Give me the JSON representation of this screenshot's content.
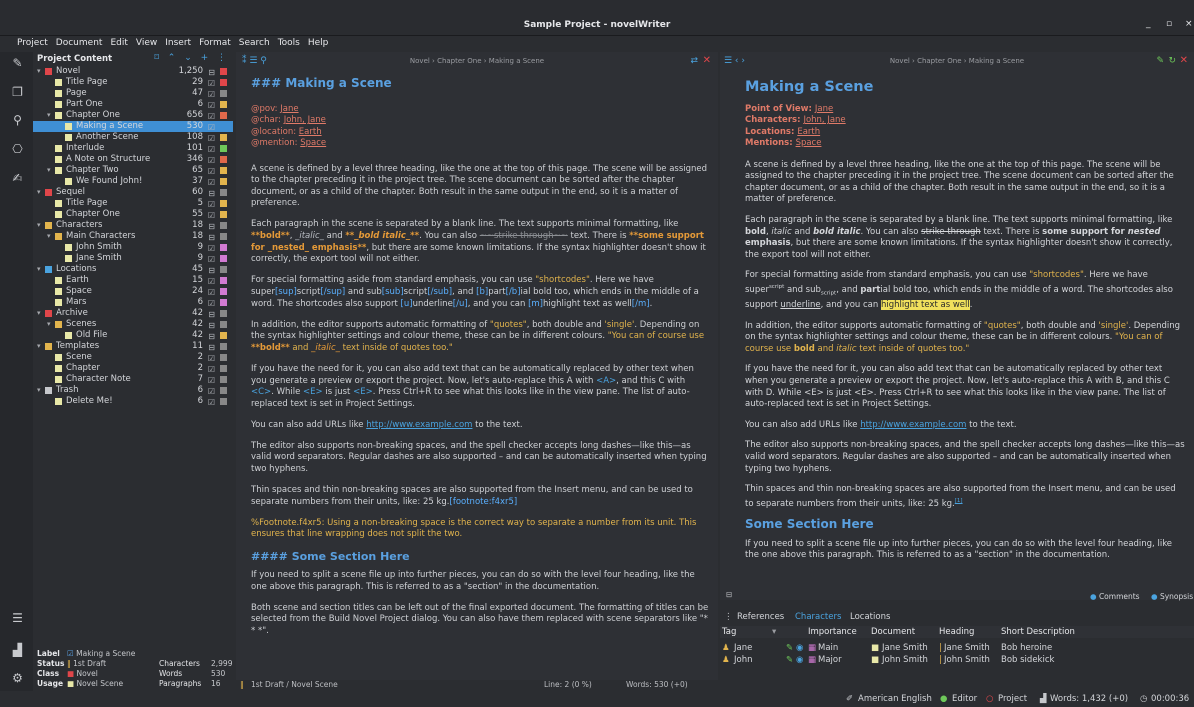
{
  "window": {
    "title": "Sample Project - novelWriter",
    "buttons": [
      "_",
      "▫",
      "×"
    ]
  },
  "menu": [
    "Project",
    "Document",
    "Edit",
    "View",
    "Insert",
    "Format",
    "Search",
    "Tools",
    "Help"
  ],
  "colors": {
    "accent": "#3f8fd4",
    "heading": "#5aa0e0",
    "meta": "#e07a68",
    "quote": "#e2b44d"
  },
  "tree": {
    "title": "Project Content",
    "rows": [
      {
        "label": "Novel",
        "count": "1,250",
        "arrow": "▾",
        "indent": 0,
        "icon": "#e0464a",
        "mark": "#e0464a",
        "bar": true
      },
      {
        "label": "Title Page",
        "count": "29",
        "indent": 1,
        "icon": "#e8e8a8",
        "mark": "#e0464a"
      },
      {
        "label": "Page",
        "count": "47",
        "indent": 1,
        "icon": "#e8e8a8",
        "mark": "#888"
      },
      {
        "label": "Part One",
        "count": "6",
        "indent": 1,
        "icon": "#e8e8a8",
        "mark": "#e2b44d"
      },
      {
        "label": "Chapter One",
        "count": "656",
        "arrow": "▾",
        "indent": 1,
        "icon": "#e8e8a8",
        "mark": "#e0684a"
      },
      {
        "label": "Making a Scene",
        "count": "530",
        "indent": 2,
        "icon": "#e8e8a8",
        "mark": "#3f8fd4",
        "sel": true
      },
      {
        "label": "Another Scene",
        "count": "108",
        "indent": 2,
        "icon": "#e8e8a8",
        "mark": "#e2b44d"
      },
      {
        "label": "Interlude",
        "count": "101",
        "indent": 1,
        "icon": "#e8e8a8",
        "mark": "#6ec85a"
      },
      {
        "label": "A Note on Structure",
        "count": "346",
        "indent": 1,
        "icon": "#e8e8a8",
        "mark": "#e0684a"
      },
      {
        "label": "Chapter Two",
        "count": "65",
        "arrow": "▾",
        "indent": 1,
        "icon": "#e8e8a8",
        "mark": "#e2b44d"
      },
      {
        "label": "We Found John!",
        "count": "37",
        "indent": 2,
        "icon": "#e8e8a8",
        "mark": "#e2b44d"
      },
      {
        "label": "Sequel",
        "count": "60",
        "arrow": "▾",
        "indent": 0,
        "icon": "#e0464a",
        "mark": "#888"
      },
      {
        "label": "Title Page",
        "count": "5",
        "indent": 1,
        "icon": "#e8e8a8",
        "mark": "#e2b44d"
      },
      {
        "label": "Chapter One",
        "count": "55",
        "indent": 1,
        "icon": "#e8e8a8",
        "mark": "#e2b44d"
      },
      {
        "label": "Characters",
        "count": "18",
        "arrow": "▾",
        "indent": 0,
        "icon": "#e2b44d",
        "mark": "#888"
      },
      {
        "label": "Main Characters",
        "count": "18",
        "arrow": "▾",
        "indent": 1,
        "icon": "#e2b44d",
        "mark": "#888"
      },
      {
        "label": "John Smith",
        "count": "9",
        "indent": 2,
        "icon": "#e8e8a8",
        "mark": "#d27ad2"
      },
      {
        "label": "Jane Smith",
        "count": "9",
        "indent": 2,
        "icon": "#e8e8a8",
        "mark": "#d27ad2"
      },
      {
        "label": "Locations",
        "count": "45",
        "arrow": "▾",
        "indent": 0,
        "icon": "#4aa3df",
        "mark": "#888"
      },
      {
        "label": "Earth",
        "count": "15",
        "indent": 1,
        "icon": "#e8e8a8",
        "mark": "#d27ad2"
      },
      {
        "label": "Space",
        "count": "24",
        "indent": 1,
        "icon": "#e8e8a8",
        "mark": "#d27ad2"
      },
      {
        "label": "Mars",
        "count": "6",
        "indent": 1,
        "icon": "#e8e8a8",
        "mark": "#d27ad2"
      },
      {
        "label": "Archive",
        "count": "42",
        "arrow": "▾",
        "indent": 0,
        "icon": "#e0464a",
        "mark": "#888"
      },
      {
        "label": "Scenes",
        "count": "42",
        "arrow": "▾",
        "indent": 1,
        "icon": "#e2b44d",
        "mark": "#888"
      },
      {
        "label": "Old File",
        "count": "42",
        "indent": 2,
        "icon": "#e8e8a8",
        "mark": "#e2b44d"
      },
      {
        "label": "Templates",
        "count": "11",
        "arrow": "▾",
        "indent": 0,
        "icon": "#e2b44d",
        "mark": "#888"
      },
      {
        "label": "Scene",
        "count": "2",
        "indent": 1,
        "icon": "#e8e8a8",
        "mark": "#888"
      },
      {
        "label": "Chapter",
        "count": "2",
        "indent": 1,
        "icon": "#e8e8a8",
        "mark": "#888"
      },
      {
        "label": "Character Note",
        "count": "7",
        "indent": 1,
        "icon": "#e8e8a8",
        "mark": "#888"
      },
      {
        "label": "Trash",
        "count": "6",
        "arrow": "▾",
        "indent": 0,
        "icon": "#c6c8cc",
        "mark": "#888"
      },
      {
        "label": "Delete Me!",
        "count": "6",
        "indent": 1,
        "icon": "#e8e8a8",
        "mark": "#888"
      }
    ]
  },
  "details": {
    "label_k": "Label",
    "label_v": "Making a Scene",
    "status_k": "Status",
    "status_v": "1st Draft",
    "class_k": "Class",
    "class_v": "Novel",
    "usage_k": "Usage",
    "usage_v": "Novel Scene",
    "chars_k": "Characters",
    "chars_v": "2,999",
    "words_k": "Words",
    "words_v": "530",
    "paras_k": "Paragraphs",
    "paras_v": "16"
  },
  "editor": {
    "path": "Novel › Chapter One › Making a Scene",
    "heading": "### Making a Scene",
    "meta": [
      {
        "k": "@pov: ",
        "v": "Jane"
      },
      {
        "k": "@char: ",
        "v": "John, Jane"
      },
      {
        "k": "@location: ",
        "v": "Earth"
      },
      {
        "k": "@mention: ",
        "v": "Space"
      }
    ],
    "p1": "A scene is defined by a level three heading, like the one at the top of this page. The scene will be assigned to the chapter preceding it in the project tree. The scene document can be sorted after the chapter document, or as a child of the chapter. Both result in the same output in the end, so it is a matter of preference.",
    "p2a": "Each paragraph in the scene is separated by a blank line. The text supports minimal formatting, like ",
    "p2b": "**bold**",
    "p2c": ", ",
    "p2d": "_italic_",
    "p2e": " and ",
    "p2f": "**_bold italic_**",
    "p2g": ". You can also ",
    "p2h": "~~strike through~~",
    "p2i": " text. There is ",
    "p2j": "**some support for _nested_ emphasis**",
    "p2k": ", but there are some known limitations. If the syntax highlighter doesn't show it correctly, the export tool will not either.",
    "p3a": "For special formatting aside from standard emphasis, you can use ",
    "p3b": "\"shortcodes\"",
    "p3c": ". Here we have super",
    "p3d": "[sup]",
    "p3e": "script",
    "p3f": "[/sup]",
    "p3g": " and sub",
    "p3h": "[sub]",
    "p3i": "script",
    "p3j": "[/sub]",
    "p3k": ", and ",
    "p3l": "[b]",
    "p3m": "part",
    "p3n": "[/b]",
    "p3o": "ial bold too, which ends in the middle of a word. The shortcodes also support ",
    "p3p": "[u]",
    "p3q": "underline",
    "p3r": "[/u]",
    "p3s": ", and you can ",
    "p3t": "[m]",
    "p3u": "highlight text as well",
    "p3v": "[/m]",
    "p3w": ".",
    "p4a": "In addition, the editor supports automatic formatting of ",
    "p4b": "\"quotes\"",
    "p4c": ", both double and ",
    "p4d": "'single'",
    "p4e": ". Depending on the syntax highlighter settings and colour theme, these can be in different colours. ",
    "p4f": "\"You can of course use ",
    "p4g": "**bold**",
    "p4h": " and ",
    "p4i": "_italic_",
    "p4j": " text inside of quotes too.\"",
    "p5a": "If you have the need for it, you can also add text that can be automatically replaced by other text when you generate a preview or export the project. Now, let's auto-replace this A with ",
    "p5b": "<A>",
    "p5c": ", and this C with ",
    "p5d": "<C>",
    "p5e": ". While ",
    "p5f": "<E>",
    "p5g": " is just ",
    "p5h": "<E>",
    "p5i": ". Press Ctrl+R to see what this looks like in the view pane. The list of auto-replaced text is set in Project Settings.",
    "p6a": "You can also add URLs like ",
    "p6b": "http://www.example.com",
    "p6c": " to the text.",
    "p7": "The editor also supports non-breaking spaces, and the spell checker accepts long dashes—like this—as valid word separators. Regular dashes are also supported – and can be automatically inserted when typing two hyphens.",
    "p8a": "Thin spaces and thin non-breaking spaces are also supported from the Insert menu, and can be used to separate numbers from their units, like: 25",
    "p8b": " kg.",
    "p8c": "[footnote:f4xr5]",
    "p9": "%Footnote.f4xr5: Using a non-breaking space is the correct way to separate a number from its unit. This ensures that line wrapping does not split the two.",
    "h4": "#### Some Section Here",
    "p10": "If you need to split a scene file up into further pieces, you can do so with the level four heading, like the one above this paragraph. This is referred to as a \"section\" in the documentation.",
    "p11": "Both scene and section titles can be left out of the final exported document. The formatting of titles can be selected from the Build Novel Project dialog. You can also have them replaced with scene separators like \"* * *\".",
    "status_left": "1st Draft / Novel Scene",
    "status_line": "Line: 2 (0 %)",
    "status_words": "Words: 530 (+0)"
  },
  "viewer": {
    "path": "Novel › Chapter One › Making a Scene",
    "heading": "Making a Scene",
    "meta": [
      {
        "k": "Point of View: ",
        "v": "Jane"
      },
      {
        "k": "Characters: ",
        "v": "John, Jane"
      },
      {
        "k": "Locations: ",
        "v": "Earth"
      },
      {
        "k": "Mentions: ",
        "v": "Space"
      }
    ],
    "p1": "A scene is defined by a level three heading, like the one at the top of this page. The scene will be assigned to the chapter preceding it in the project tree. The scene document can be sorted after the chapter document, or as a child of the chapter. Both result in the same output in the end, so it is a matter of preference.",
    "p2a": "Each paragraph in the scene is separated by a blank line. The text supports minimal formatting, like ",
    "p2b": "bold",
    "p2c": ", ",
    "p2d": "italic",
    "p2e": " and ",
    "p2f": "bold italic",
    "p2g": ". You can also ",
    "p2h": "strike through",
    "p2i": " text. There is ",
    "p2j1": "some support for ",
    "p2j2": "nested",
    "p2j3": " emphasis",
    "p2k": ", but there are some known limitations. If the syntax highlighter doesn't show it correctly, the export tool will not either.",
    "p3a": "For special formatting aside from standard emphasis, you can use ",
    "p3b": "\"shortcodes\"",
    "p3c": ". Here we have super",
    "p3d": "script",
    "p3e": " and sub",
    "p3f": "script",
    "p3g": ", and ",
    "p3h": "part",
    "p3i": "ial bold too, which ends in the middle of a word. The shortcodes also support ",
    "p3j": "underline",
    "p3k": ", and you can ",
    "p3l": "highlight text as well",
    "p3m": ".",
    "p4a": "In addition, the editor supports automatic formatting of ",
    "p4b": "\"quotes\"",
    "p4c": ", both double and ",
    "p4d": "'single'",
    "p4e": ". Depending on the syntax highlighter settings and colour theme, these can be in different colours. ",
    "p4f": "\"You can of course use ",
    "p4g": "bold",
    "p4h": " and ",
    "p4i": "italic",
    "p4j": " text inside of quotes too.\"",
    "p5": "If you have the need for it, you can also add text that can be automatically replaced by other text when you generate a preview or export the project. Now, let's auto-replace this A with B, and this C with D. While <E> is just <E>. Press Ctrl+R to see what this looks like in the view pane. The list of auto-replaced text is set in Project Settings.",
    "p6a": "You can also add URLs like ",
    "p6b": "http://www.example.com",
    "p6c": " to the text.",
    "p7": "The editor also supports non-breaking spaces, and the spell checker accepts long dashes—like this—as valid word separators. Regular dashes are also supported – and can be automatically inserted when typing two hyphens.",
    "p8a": "Thin spaces and thin non-breaking spaces are also supported from the Insert menu, and can be used to separate numbers from their units, like: 25 kg.",
    "p8b": "[1]",
    "h2": "Some Section Here",
    "p9": "If you need to split a scene file up into further pieces, you can do so with the level four heading, like the one above this paragraph. This is referred to as a \"section\" in the documentation.",
    "comments": "Comments",
    "synopsis": "Synopsis"
  },
  "refs": {
    "tabs": [
      "References",
      "Characters",
      "Locations"
    ],
    "active_tab": 1,
    "headers": [
      "Tag",
      "Importance",
      "Document",
      "Heading",
      "Short Description"
    ],
    "rows": [
      {
        "tag": "Jane",
        "importance": "Main",
        "document": "Jane Smith",
        "heading": "Jane Smith",
        "desc": "Bob heroine"
      },
      {
        "tag": "John",
        "importance": "Major",
        "document": "John Smith",
        "heading": "John Smith",
        "desc": "Bob sidekick"
      }
    ]
  },
  "status": {
    "language": "American English",
    "editor": "Editor",
    "project": "Project",
    "words": "Words: 1,432 (+0)",
    "time": "00:00:36"
  }
}
